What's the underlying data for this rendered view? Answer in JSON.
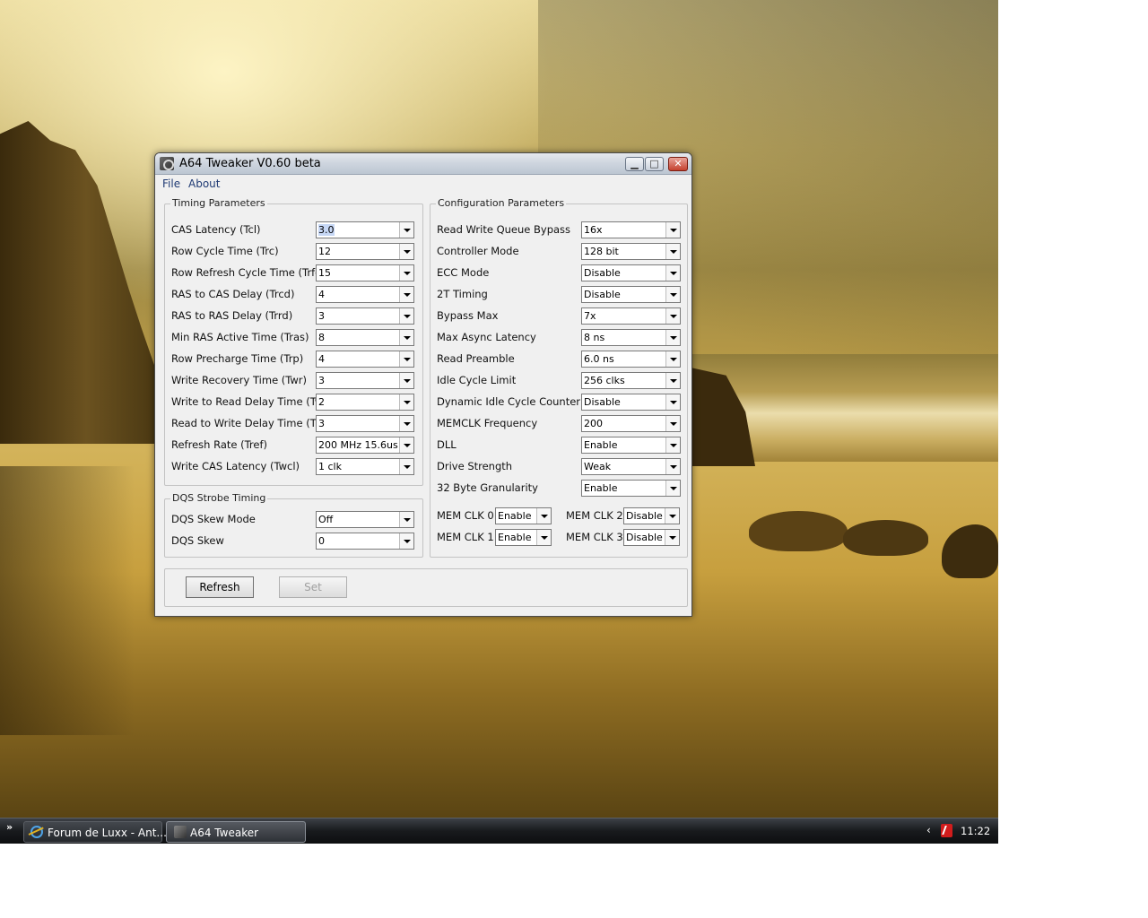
{
  "window": {
    "title": "A64 Tweaker V0.60 beta",
    "menu": [
      "File",
      "About"
    ]
  },
  "timing": {
    "title": "Timing Parameters",
    "rows": [
      {
        "label": "CAS Latency (Tcl)",
        "value": "3.0"
      },
      {
        "label": "Row Cycle Time (Trc)",
        "value": "12"
      },
      {
        "label": "Row Refresh Cycle Time (Trfc)",
        "value": "15"
      },
      {
        "label": "RAS to CAS Delay (Trcd)",
        "value": "4"
      },
      {
        "label": "RAS to RAS Delay (Trrd)",
        "value": "3"
      },
      {
        "label": "Min RAS Active Time (Tras)",
        "value": "8"
      },
      {
        "label": "Row Precharge Time (Trp)",
        "value": "4"
      },
      {
        "label": "Write Recovery Time (Twr)",
        "value": "3"
      },
      {
        "label": "Write to Read Delay Time (Twtr)",
        "value": "2"
      },
      {
        "label": "Read to Write Delay Time (Trtw)",
        "value": "3"
      },
      {
        "label": "Refresh Rate (Tref)",
        "value": "200 MHz 15.6us"
      },
      {
        "label": "Write CAS Latency (Twcl)",
        "value": "1 clk"
      }
    ]
  },
  "dqs": {
    "title": "DQS Strobe Timing",
    "rows": [
      {
        "label": "DQS Skew Mode",
        "value": "Off"
      },
      {
        "label": "DQS Skew",
        "value": "0"
      }
    ]
  },
  "config": {
    "title": "Configuration Parameters",
    "rows": [
      {
        "label": "Read Write Queue Bypass",
        "value": "16x"
      },
      {
        "label": "Controller Mode",
        "value": "128 bit"
      },
      {
        "label": "ECC Mode",
        "value": "Disable"
      },
      {
        "label": "2T Timing",
        "value": "Disable"
      },
      {
        "label": "Bypass Max",
        "value": "7x"
      },
      {
        "label": "Max Async Latency",
        "value": "8 ns"
      },
      {
        "label": "Read Preamble",
        "value": "6.0 ns"
      },
      {
        "label": "Idle Cycle Limit",
        "value": "256 clks"
      },
      {
        "label": "Dynamic Idle Cycle Counter",
        "value": "Disable"
      },
      {
        "label": "MEMCLK Frequency",
        "value": "200"
      },
      {
        "label": "DLL",
        "value": "Enable"
      },
      {
        "label": "Drive Strength",
        "value": "Weak"
      },
      {
        "label": "32 Byte Granularity",
        "value": "Enable"
      }
    ],
    "memclk": [
      {
        "label": "MEM CLK 0",
        "value": "Enable"
      },
      {
        "label": "MEM CLK 1",
        "value": "Enable"
      },
      {
        "label": "MEM CLK 2",
        "value": "Disable"
      },
      {
        "label": "MEM CLK 3",
        "value": "Disable"
      }
    ]
  },
  "buttons": {
    "refresh": "Refresh",
    "set": "Set"
  },
  "taskbar": {
    "tasks": [
      "Forum de Luxx - Ant...",
      "A64 Tweaker"
    ],
    "clock": "11:22",
    "chevron": "»"
  }
}
